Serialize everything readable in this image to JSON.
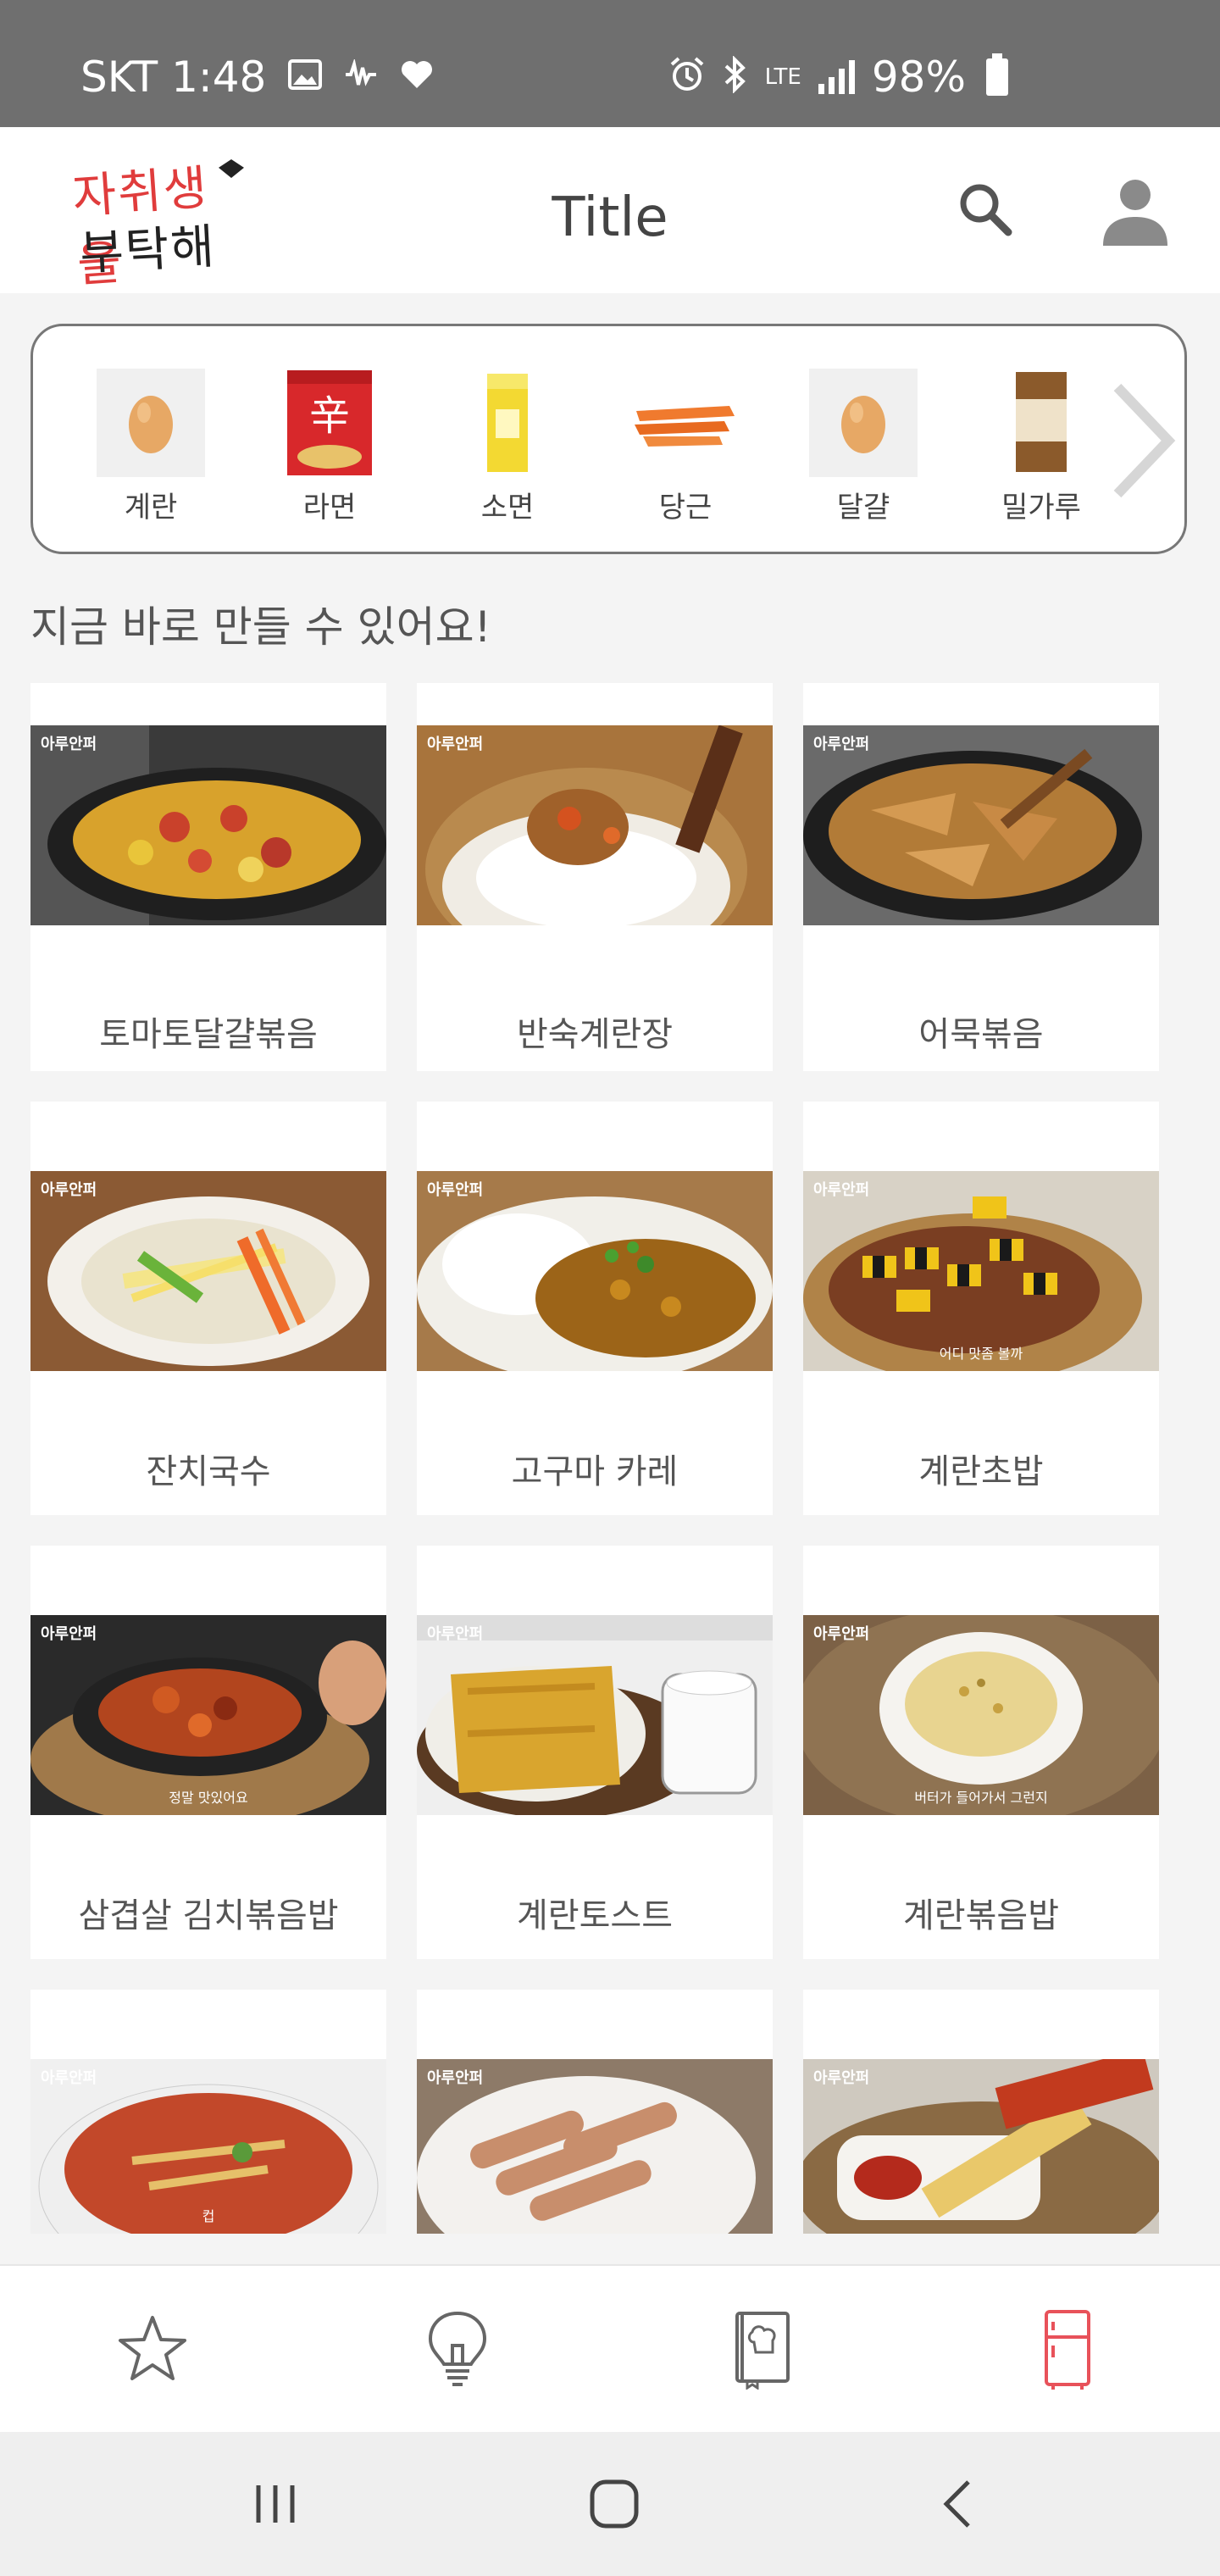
{
  "status_bar": {
    "carrier_time": "SKT 1:48",
    "network": "LTE",
    "battery": "98%"
  },
  "header": {
    "logo_line1": "자취생을",
    "logo_line2": "부탁해",
    "title": "Title"
  },
  "ingredients": [
    {
      "label": "계란",
      "icon": "egg"
    },
    {
      "label": "라면",
      "icon": "ramen-pack"
    },
    {
      "label": "소면",
      "icon": "noodle-pack"
    },
    {
      "label": "당근",
      "icon": "carrot"
    },
    {
      "label": "달걀",
      "icon": "egg"
    },
    {
      "label": "밀가루",
      "icon": "flour-bag"
    }
  ],
  "section_heading": "지금 바로 만들 수 있어요!",
  "recipes": [
    {
      "name": "토마토달걀볶음",
      "tag": "아루안퍼",
      "caption": ""
    },
    {
      "name": "반숙계란장",
      "tag": "아루안퍼",
      "caption": ""
    },
    {
      "name": "어묵볶음",
      "tag": "아루안퍼",
      "caption": ""
    },
    {
      "name": "잔치국수",
      "tag": "아루안퍼",
      "caption": ""
    },
    {
      "name": "고구마 카레",
      "tag": "아루안퍼",
      "caption": ""
    },
    {
      "name": "계란초밥",
      "tag": "아루안퍼",
      "caption": "어디 맛좀 볼까"
    },
    {
      "name": "삼겹살 김치볶음밥",
      "tag": "아루안퍼",
      "caption": "정말 맛있어요"
    },
    {
      "name": "계란토스트",
      "tag": "아루안퍼",
      "caption": ""
    },
    {
      "name": "계란볶음밥",
      "tag": "아루안퍼",
      "caption": "버터가 들어가서 그런지"
    },
    {
      "name": "",
      "tag": "아루안퍼",
      "caption": "컵"
    },
    {
      "name": "",
      "tag": "아루안퍼",
      "caption": ""
    },
    {
      "name": "",
      "tag": "아루안퍼",
      "caption": ""
    }
  ],
  "bottom_nav": [
    {
      "name": "favorites",
      "icon": "star-icon",
      "active": false
    },
    {
      "name": "tips",
      "icon": "lightbulb-icon",
      "active": false
    },
    {
      "name": "recipe-book",
      "icon": "chef-book-icon",
      "active": false
    },
    {
      "name": "fridge",
      "icon": "fridge-icon",
      "active": true
    }
  ],
  "colors": {
    "status_bar": "#6f6f6f",
    "accent": "#e8525a",
    "logo_red": "#e03c3c"
  }
}
